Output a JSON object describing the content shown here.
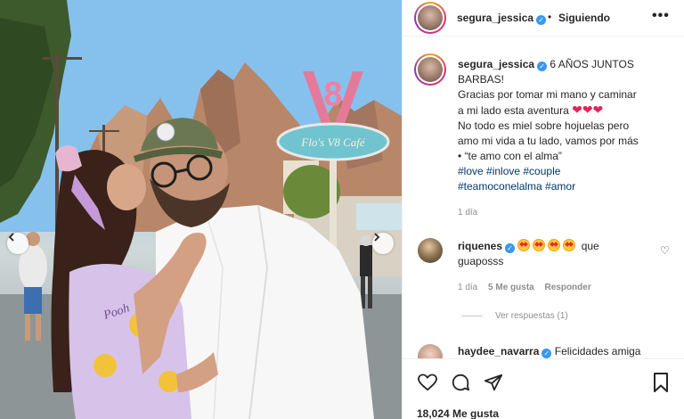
{
  "post": {
    "username": "segura_jessica",
    "follow_separator": "•",
    "follow_status": "Siguiendo",
    "more_icon": "more-horizontal-icon"
  },
  "caption": {
    "username": "segura_jessica",
    "line1": "6 AÑOS JUNTOS",
    "line2": "BARBAS!",
    "line3": "Gracias por tomar mi mano y caminar",
    "line4": "a mi lado esta aventura",
    "hearts": "❤❤❤",
    "line5": "No todo es miel sobre hojuelas pero",
    "line6": "amo mi vida a tu lado, vamos por más",
    "line7": "• “te amo con el alma”",
    "hashtags_line1": "#love #inlove #couple",
    "hashtags_line2": "#teamoconelalma #amor",
    "age": "1 día"
  },
  "comment": {
    "username": "riquenes",
    "text_after": "que",
    "text_line2": "guaposss",
    "age": "1 día",
    "likes": "5 Me gusta",
    "reply": "Responder",
    "view_replies": "Ver respuestas (1)"
  },
  "comment2": {
    "username": "haydee_navarra",
    "text": "Felicidades amiga"
  },
  "footer": {
    "likes": "18,024 Me gusta"
  },
  "photo": {
    "sign_number": "8",
    "sign_text": "Flo's V8 Café",
    "shirt_text": "Pooh"
  },
  "colors": {
    "accent_blue": "#3897f0",
    "hashtag": "#00376b",
    "heart": "#e0245e",
    "muted": "#8e8e8e"
  }
}
